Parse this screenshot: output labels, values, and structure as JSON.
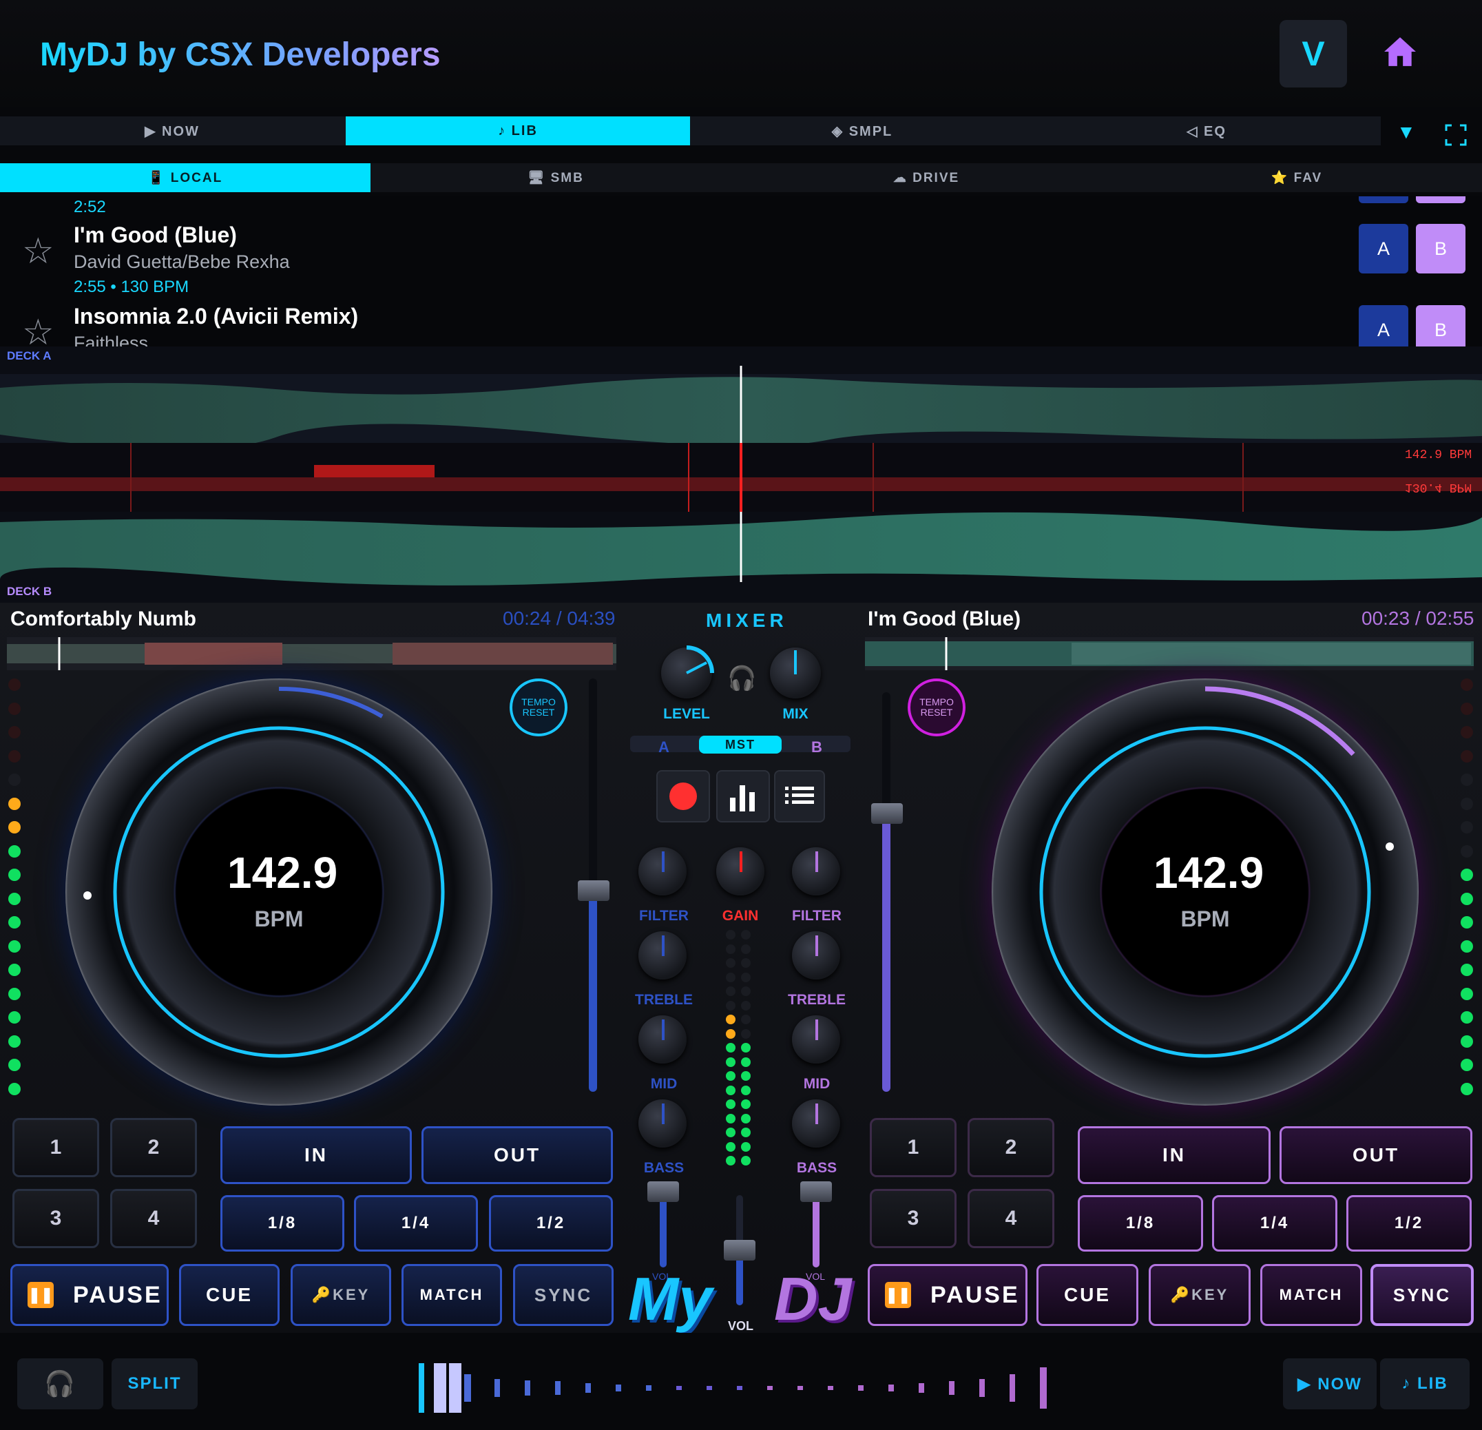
{
  "header": {
    "title": "MyDJ by CSX Developers",
    "v_label": "V"
  },
  "tabs": {
    "main": [
      "▶ NOW",
      "♪ LIB",
      "◈ SMPL",
      "◁ EQ"
    ],
    "sources": [
      "📱 LOCAL",
      "🖥 SMB",
      "☁ DRIVE",
      "⭐ FAV"
    ]
  },
  "library": {
    "prev_duration": "2:52",
    "tracks": [
      {
        "title": "I'm Good (Blue)",
        "artist": "David Guetta/Bebe Rexha",
        "meta": "2:55  •  130 BPM"
      },
      {
        "title": "Insomnia 2.0 (Avicii Remix)",
        "artist": "Faithless"
      }
    ],
    "a_label": "A",
    "b_label": "B"
  },
  "waveform": {
    "deck_a_label": "DECK A",
    "deck_b_label": "DECK B",
    "bpm_top": "142.9 BPM",
    "bpm_bottom": "130.4 BPM"
  },
  "deck_a": {
    "title": "Comfortably Numb",
    "time": "00:24 / 04:39",
    "bpm": "142.9",
    "bpm_unit": "BPM",
    "tempo_reset": "TEMPO\nRESET",
    "pads": [
      "1",
      "2",
      "3",
      "4"
    ],
    "loop_in": "IN",
    "loop_out": "OUT",
    "loops": [
      "1/8",
      "1/4",
      "1/2"
    ],
    "pause": "PAUSE",
    "cue": "CUE",
    "key": "🔑KEY",
    "match": "MATCH",
    "sync": "SYNC",
    "accent": "#2e52c6"
  },
  "deck_b": {
    "title": "I'm Good (Blue)",
    "time": "00:23 / 02:55",
    "bpm": "142.9",
    "bpm_unit": "BPM",
    "tempo_reset": "TEMPO\nRESET",
    "pads": [
      "1",
      "2",
      "3",
      "4"
    ],
    "loop_in": "IN",
    "loop_out": "OUT",
    "loops": [
      "1/8",
      "1/4",
      "1/2"
    ],
    "pause": "PAUSE",
    "cue": "CUE",
    "key": "🔑KEY",
    "match": "MATCH",
    "sync": "SYNC",
    "accent": "#b375e0"
  },
  "mixer": {
    "title": "MIXER",
    "level": "LEVEL",
    "mix": "MIX",
    "a": "A",
    "mst": "MST",
    "b": "B",
    "filter": "FILTER",
    "gain": "GAIN",
    "treble": "TREBLE",
    "mid": "MID",
    "bass": "BASS",
    "vol": "VOL",
    "vol_small": "VOL",
    "logo_my": "My",
    "logo_dj": "DJ"
  },
  "bottom": {
    "split": "SPLIT",
    "now": "▶ NOW",
    "lib": "♪ LIB"
  },
  "colors": {
    "cyan": "#00e0ff",
    "deck_a": "#2e52c6",
    "deck_b": "#b375e0",
    "record": "#ff3030"
  }
}
